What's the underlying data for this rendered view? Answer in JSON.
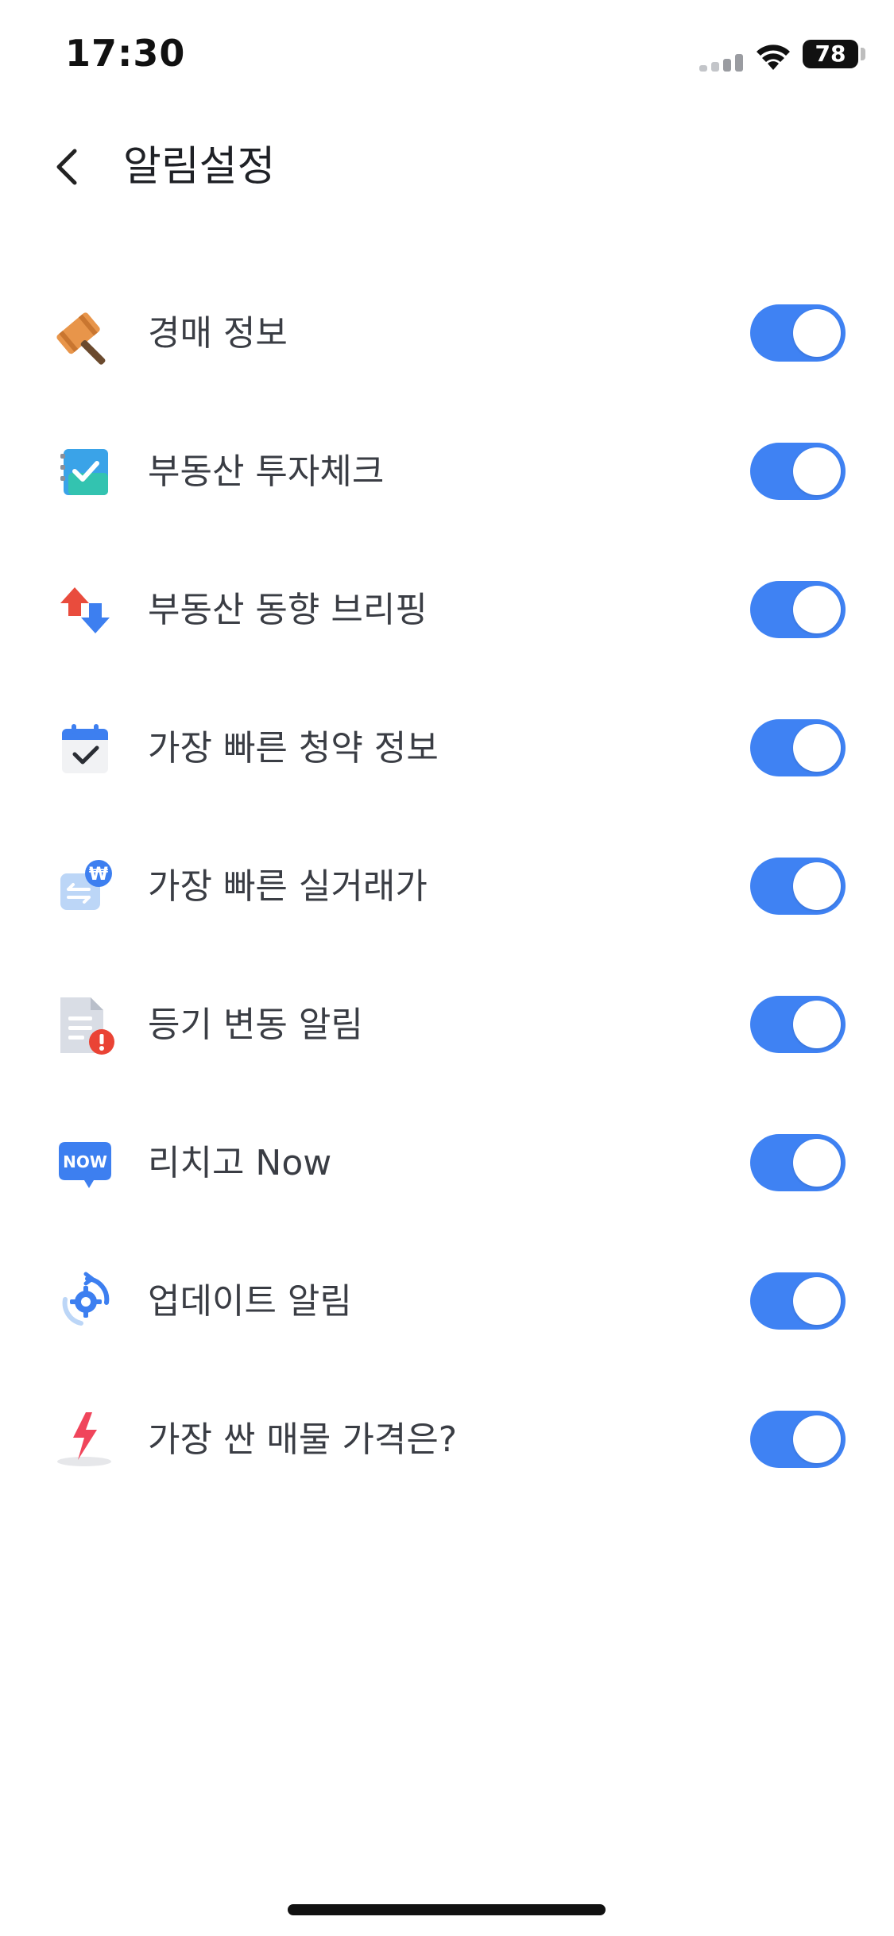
{
  "status_bar": {
    "time": "17:30",
    "battery": "78",
    "signal_icon": "cellular-signal-icon",
    "wifi_icon": "wifi-icon",
    "battery_icon": "battery-icon"
  },
  "header": {
    "title": "알림설정",
    "back_icon": "chevron-left-icon"
  },
  "colors": {
    "toggle_on": "#3f82f3",
    "text": "#3a3d44",
    "background": "#ffffff"
  },
  "settings": [
    {
      "label": "경매 정보",
      "icon": "gavel-icon",
      "enabled": true
    },
    {
      "label": "부동산 투자체크",
      "icon": "checklist-icon",
      "enabled": true
    },
    {
      "label": "부동산 동향 브리핑",
      "icon": "up-down-arrows-icon",
      "enabled": true
    },
    {
      "label": "가장 빠른 청약 정보",
      "icon": "calendar-check-icon",
      "enabled": true
    },
    {
      "label": "가장 빠른 실거래가",
      "icon": "won-transaction-icon",
      "enabled": true
    },
    {
      "label": "등기 변동 알림",
      "icon": "document-alert-icon",
      "enabled": true
    },
    {
      "label": "리치고 Now",
      "icon": "now-badge-icon",
      "enabled": true
    },
    {
      "label": "업데이트 알림",
      "icon": "gear-refresh-icon",
      "enabled": true
    },
    {
      "label": "가장 싼 매물 가격은?",
      "icon": "lightning-icon",
      "enabled": true
    }
  ]
}
